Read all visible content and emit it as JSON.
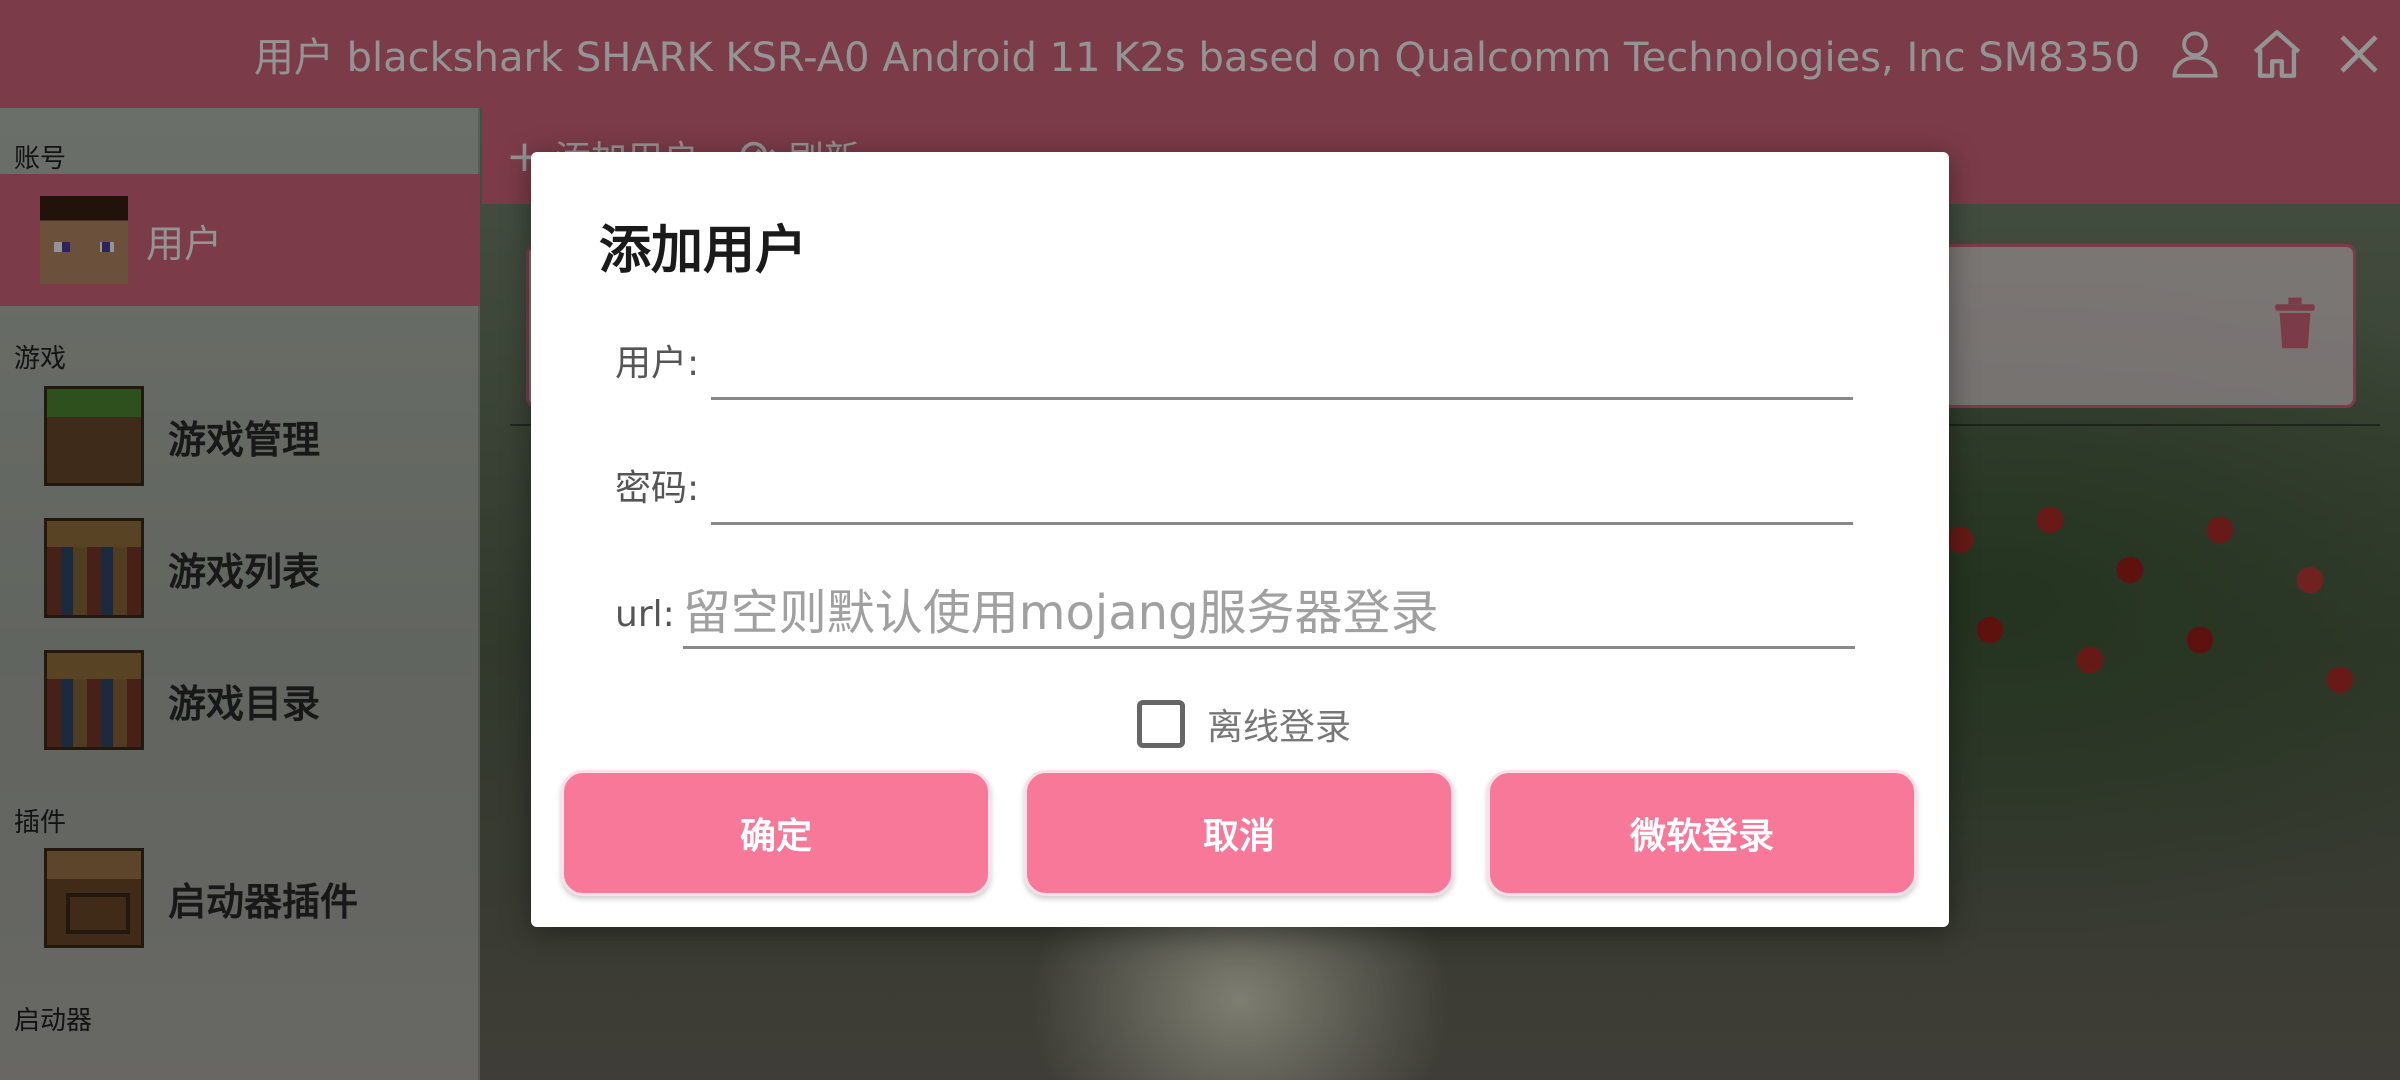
{
  "topbar": {
    "title": "用户   blackshark SHARK KSR-A0 Android 11  K2s based on Qualcomm Technologies, Inc SM8350",
    "icons": [
      "user-icon",
      "home-icon",
      "close-icon"
    ]
  },
  "sidebar": {
    "sections": {
      "account": "账号",
      "game": "游戏",
      "plugin": "插件",
      "launcher": "启动器"
    },
    "items": {
      "user": "用户",
      "game_manage": "游戏管理",
      "game_list": "游戏列表",
      "game_dir": "游戏目录",
      "launcher_plugin": "启动器插件"
    }
  },
  "content_bar": {
    "add_user": "添加用户",
    "refresh": "刷新"
  },
  "dialog": {
    "title": "添加用户",
    "username_label": "用户:",
    "username_value": "",
    "password_label": "密码:",
    "password_value": "",
    "url_label": "url:",
    "url_placeholder": "留空则默认使用mojang服务器登录",
    "offline_label": "离线登录",
    "offline_checked": false,
    "confirm": "确定",
    "cancel": "取消",
    "microsoft_login": "微软登录"
  },
  "colors": {
    "accent": "#d6667f",
    "button": "#f77898"
  }
}
